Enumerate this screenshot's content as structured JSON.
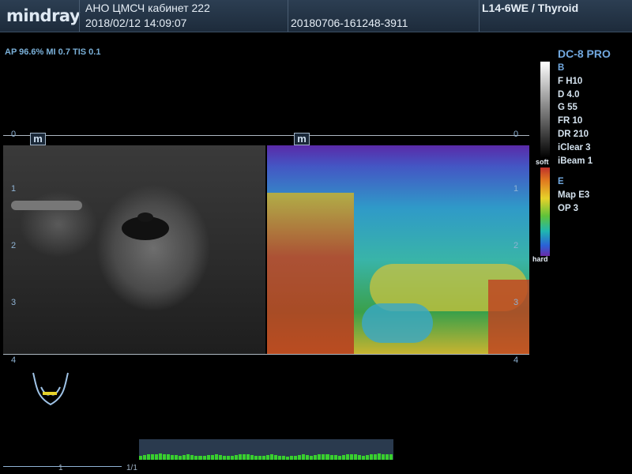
{
  "header": {
    "brand": "mindray",
    "facility": "АНО ЦМСЧ кабинет  222",
    "datetime": "2018/02/12  14:09:07",
    "exam_id": "20180706-161248-3911",
    "probe": "L14-6WE / Thyroid"
  },
  "measurements": "AP 96.6%  MI 0.7  TIS 0.1",
  "side_panel": {
    "title": "DC-8 PRO",
    "b_section": "B",
    "b_params": [
      "F H10",
      "D 4.0",
      "G 55",
      "FR 10",
      "DR 210",
      "iClear 3",
      "iBeam 1"
    ],
    "e_section": "E",
    "e_params": [
      "Map E3",
      "OP 3"
    ],
    "soft_label": "soft",
    "hard_label": "hard"
  },
  "depth_scale": {
    "left_ticks": [
      "0",
      "1",
      "2",
      "3",
      "4"
    ],
    "right_ticks": [
      "0",
      "1",
      "2",
      "3",
      "4"
    ]
  },
  "marker_label": "m",
  "cine": {
    "frame_label": "1",
    "page": "1/1",
    "bar_levels": [
      0.45,
      0.5,
      0.55,
      0.6,
      0.6,
      0.65,
      0.6,
      0.55,
      0.5,
      0.5,
      0.45,
      0.5,
      0.55,
      0.5,
      0.45,
      0.4,
      0.45,
      0.5,
      0.5,
      0.55,
      0.5,
      0.45,
      0.4,
      0.45,
      0.5,
      0.55,
      0.6,
      0.55,
      0.5,
      0.45,
      0.4,
      0.45,
      0.5,
      0.55,
      0.5,
      0.45,
      0.4,
      0.35,
      0.4,
      0.45,
      0.5,
      0.55,
      0.5,
      0.45,
      0.5,
      0.55,
      0.6,
      0.55,
      0.5,
      0.5,
      0.45,
      0.5,
      0.55,
      0.6,
      0.55,
      0.5,
      0.45,
      0.5,
      0.55,
      0.6,
      0.65,
      0.6,
      0.55,
      0.6
    ]
  },
  "colors": {
    "accent": "#72a9e0",
    "cine_bar": "#39d02e"
  }
}
